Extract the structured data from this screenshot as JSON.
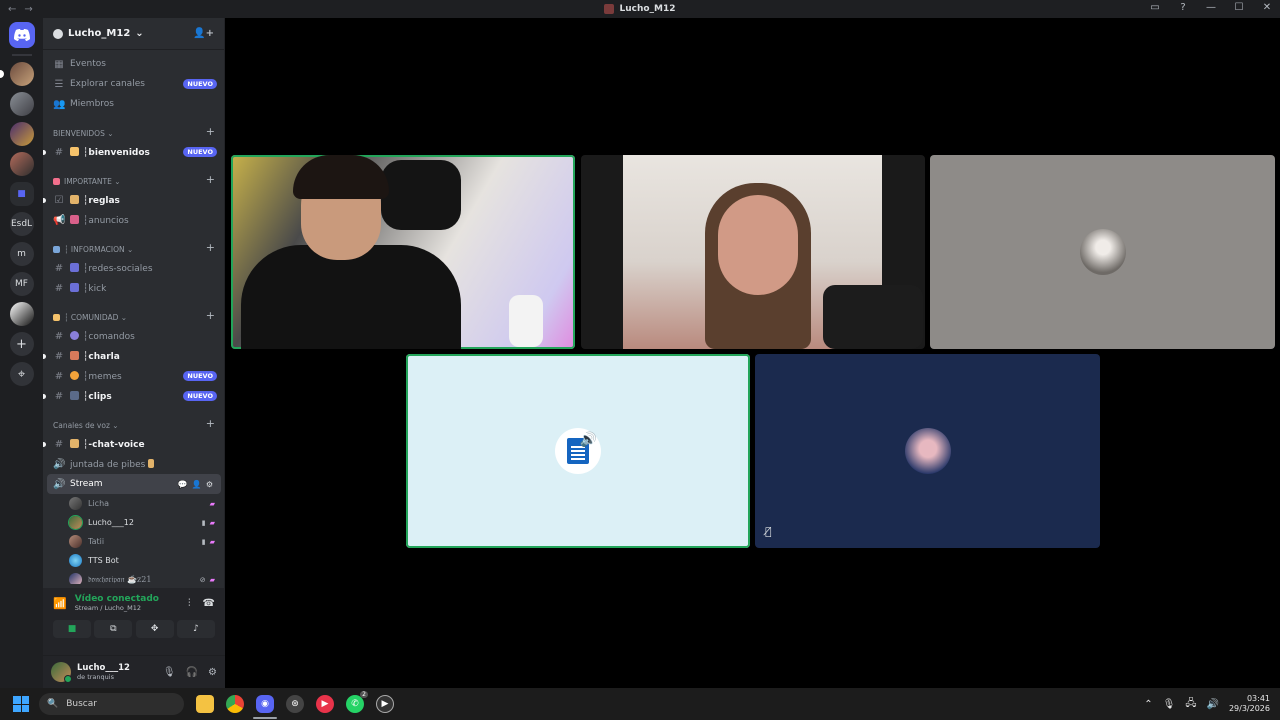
{
  "window": {
    "title": "Lucho_M12",
    "nav_back": "←",
    "nav_forward": "→",
    "controls": [
      "▭",
      "?",
      "—",
      "☐",
      "✕"
    ]
  },
  "rail": {
    "servers": [
      "",
      "",
      "",
      "",
      "",
      "EsdL",
      "m",
      "MF",
      "",
      "+",
      "⌖"
    ]
  },
  "guild": {
    "name": "Lucho_M12",
    "chevron": "⌄"
  },
  "top_items": [
    {
      "label": "Eventos",
      "icon": "calendar-icon",
      "badge": ""
    },
    {
      "label": "Explorar canales",
      "icon": "list-icon",
      "badge": "NUEVO"
    },
    {
      "label": "Miembros",
      "icon": "members-icon",
      "badge": ""
    }
  ],
  "categories": {
    "bienvenidos": "BIENVENIDOS",
    "importante": "IMPORTANTE",
    "informacion": "┆ INFORMACION",
    "comunidad": "┆ COMUNIDAD",
    "voz": "Canales de voz"
  },
  "channels": {
    "bienvenidos": {
      "label": "┆bienvenidos",
      "badge": "NUEVO"
    },
    "reglas": {
      "label": "┆reglas"
    },
    "anuncios": {
      "label": "┆anuncios"
    },
    "redes": {
      "label": "┆redes-sociales"
    },
    "kick": {
      "label": "┆kick"
    },
    "comandos": {
      "label": "┆comandos"
    },
    "charla": {
      "label": "┆charla"
    },
    "memes": {
      "label": "┆memes",
      "badge": "NUEVO"
    },
    "clips": {
      "label": "┆clips",
      "badge": "NUEVO"
    },
    "chatvoice": {
      "label": "┆-chat-voice"
    },
    "juntada": {
      "label": "juntada de pibes"
    },
    "stream": {
      "label": "Stream"
    }
  },
  "voice_users": [
    {
      "name": "Licha"
    },
    {
      "name": "Lucho___12"
    },
    {
      "name": "Tatii"
    },
    {
      "name": "TTS Bot"
    },
    {
      "name": "𝔡𝔬𝔫𝔠𝔥𝔬𝔯𝔦𝔭𝔞𝔫 ☕z21"
    }
  ],
  "voice_panel": {
    "status": "Vídeo conectado",
    "sub": "Stream / Lucho_M12"
  },
  "user_panel": {
    "name": "Lucho___12",
    "status": "de tranquis"
  },
  "taskbar": {
    "search_placeholder": "Buscar",
    "whatsapp_count": "2",
    "time": "03:41",
    "date": "29/3/2026"
  },
  "colors": {
    "accent": "#5865f2",
    "green": "#23a55a",
    "sidebar": "#2b2d31"
  }
}
